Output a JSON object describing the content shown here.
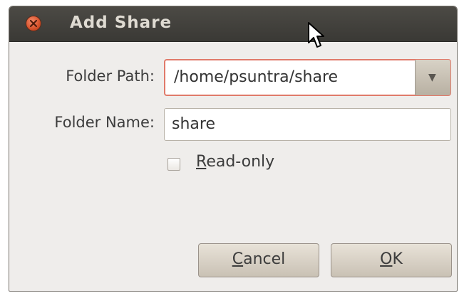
{
  "dialog": {
    "title": "Add Share"
  },
  "form": {
    "folder_path_label": "Folder Path:",
    "folder_path_value": "/home/psuntra/share",
    "folder_name_label": "Folder Name:",
    "folder_name_value": "share",
    "readonly_label_mnemonic": "R",
    "readonly_label_rest": "ead-only",
    "readonly_checked": false
  },
  "buttons": {
    "cancel_mnemonic": "C",
    "cancel_rest": "ancel",
    "ok_mnemonic": "O",
    "ok_rest": "K"
  },
  "colors": {
    "titlebar": "#3f3e3a",
    "close_button": "#d5512a",
    "focus_border": "#e07a6a",
    "dialog_background": "#efedeb"
  },
  "icons": {
    "close": "close-icon",
    "dropdown": "chevron-down-icon",
    "pointer": "mouse-pointer-icon"
  }
}
